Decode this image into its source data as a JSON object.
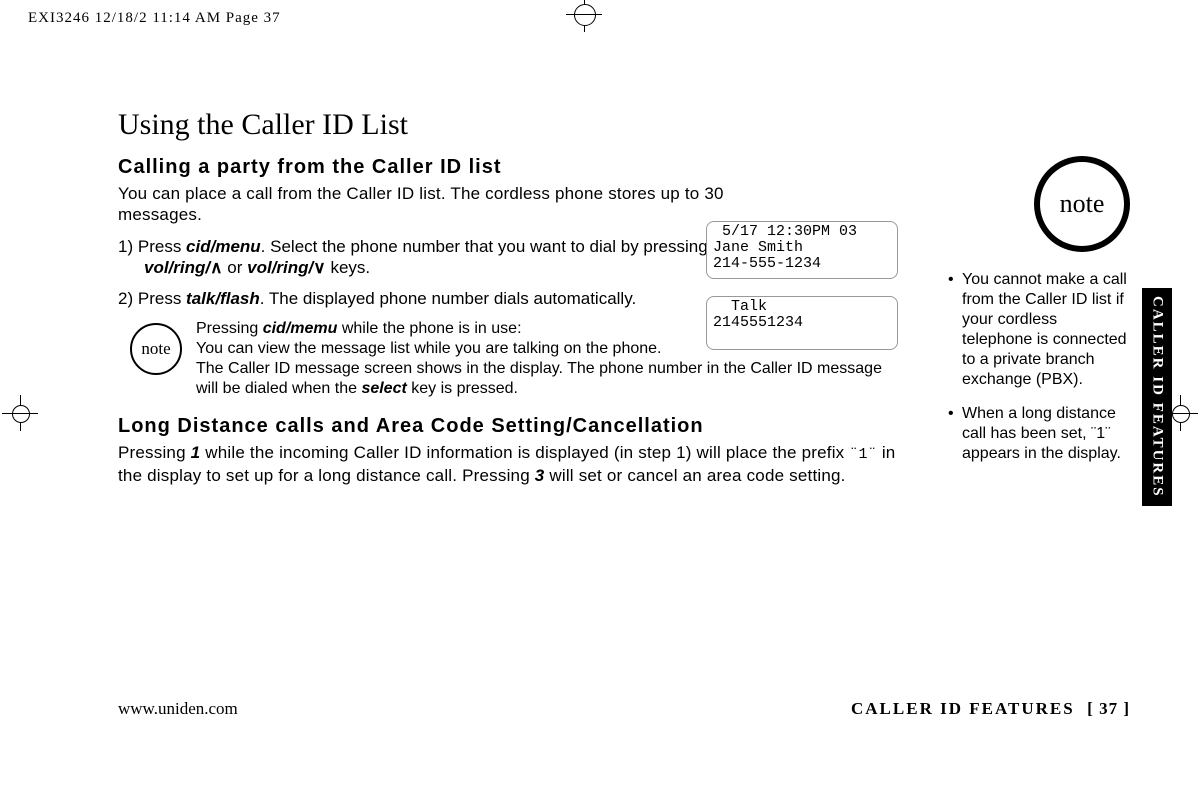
{
  "slug": "EXI3246  12/18/2  11:14 AM  Page 37",
  "sideTab": "CALLER  ID  FEATURES",
  "title": "Using the Caller ID List",
  "section1": {
    "heading": "Calling a party from the Caller ID list",
    "intro": "You can place a call from the Caller ID list. The cordless phone stores up to 30 messages.",
    "steps": [
      {
        "num": "1)",
        "pre": "Press ",
        "key1": "cid/menu",
        "mid1": ". Select the phone number that you want to dial by pressing ",
        "key2": "vol/ring/",
        "arrow2": "∧",
        "mid2": " or ",
        "key3": "vol/ring/",
        "arrow3": "∨",
        "post": " keys."
      },
      {
        "num": "2)",
        "pre": "Press ",
        "key1": "talk/flash",
        "post": ". The displayed phone number dials automatically."
      }
    ]
  },
  "lcd1": " 5/17 12:30PM 03\nJane Smith\n214-555-1234",
  "lcd2": "  Talk\n2145551234",
  "tip": {
    "label": "note",
    "lead": "Pressing ",
    "key1": "cid/memu",
    "line1rest": " while the phone is in use:",
    "line2": "You can view the message list while you are talking on the phone.",
    "line3a": "The Caller ID message screen shows in the display. The phone number in the Caller ID message will be dialed when the ",
    "key2": "select",
    "line3b": " key is pressed."
  },
  "section2": {
    "heading": "Long Distance calls and Area Code Setting/Cancellation",
    "p_a": "Pressing ",
    "k1": "1",
    "p_b": " while the incoming Caller ID information is displayed (in step 1) will place the prefix ",
    "code": "¨1¨",
    "p_c": " in the display to set up for a long distance call. Pressing ",
    "k3": "3",
    "p_d": " will set or cancel an area code setting."
  },
  "sideNote": {
    "label": "note",
    "items": [
      "You cannot make a call from the Caller ID list if your cordless telephone is connected to a private branch exchange (PBX).",
      "When a long distance call has been set, ¨1¨ appears in the display."
    ]
  },
  "footer": {
    "url": "www.uniden.com",
    "section": "CALLER  ID  FEATURES",
    "page": "[ 37 ]"
  }
}
